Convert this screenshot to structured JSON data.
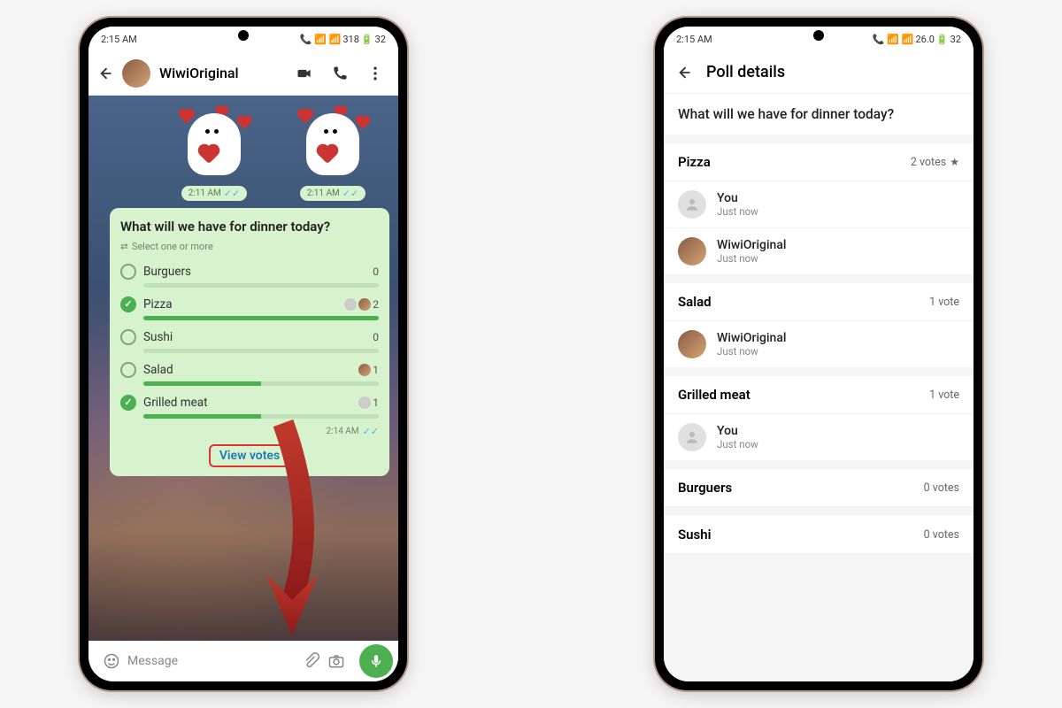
{
  "status": {
    "time_left": "2:15 AM",
    "time_right": "2:15 AM",
    "net_left": "318",
    "net_right": "26.0",
    "bat": "32"
  },
  "left": {
    "contact": "WiwiOriginal",
    "sticker_time": "2:11 AM",
    "poll": {
      "question": "What will we have for dinner today?",
      "hint": "Select one or more",
      "options": [
        {
          "label": "Burguers",
          "count": 0,
          "checked": false,
          "pct": 0,
          "avatars": []
        },
        {
          "label": "Pizza",
          "count": 2,
          "checked": true,
          "pct": 100,
          "avatars": [
            "grey",
            "photo"
          ]
        },
        {
          "label": "Sushi",
          "count": 0,
          "checked": false,
          "pct": 0,
          "avatars": []
        },
        {
          "label": "Salad",
          "count": 1,
          "checked": false,
          "pct": 50,
          "avatars": [
            "photo"
          ]
        },
        {
          "label": "Grilled meat",
          "count": 1,
          "checked": true,
          "pct": 50,
          "avatars": [
            "grey"
          ]
        }
      ],
      "time": "2:14 AM",
      "view_votes": "View votes"
    },
    "input_placeholder": "Message"
  },
  "right": {
    "title": "Poll details",
    "question": "What will we have for dinner today?",
    "groups": [
      {
        "name": "Pizza",
        "votes_label": "2 votes",
        "starred": true,
        "voters": [
          {
            "name": "You",
            "when": "Just now",
            "avatar": "grey"
          },
          {
            "name": "WiwiOriginal",
            "when": "Just now",
            "avatar": "photo"
          }
        ]
      },
      {
        "name": "Salad",
        "votes_label": "1 vote",
        "starred": false,
        "voters": [
          {
            "name": "WiwiOriginal",
            "when": "Just now",
            "avatar": "photo"
          }
        ]
      },
      {
        "name": "Grilled meat",
        "votes_label": "1 vote",
        "starred": false,
        "voters": [
          {
            "name": "You",
            "when": "Just now",
            "avatar": "grey"
          }
        ]
      },
      {
        "name": "Burguers",
        "votes_label": "0 votes",
        "starred": false,
        "voters": []
      },
      {
        "name": "Sushi",
        "votes_label": "0 votes",
        "starred": false,
        "voters": []
      }
    ]
  }
}
